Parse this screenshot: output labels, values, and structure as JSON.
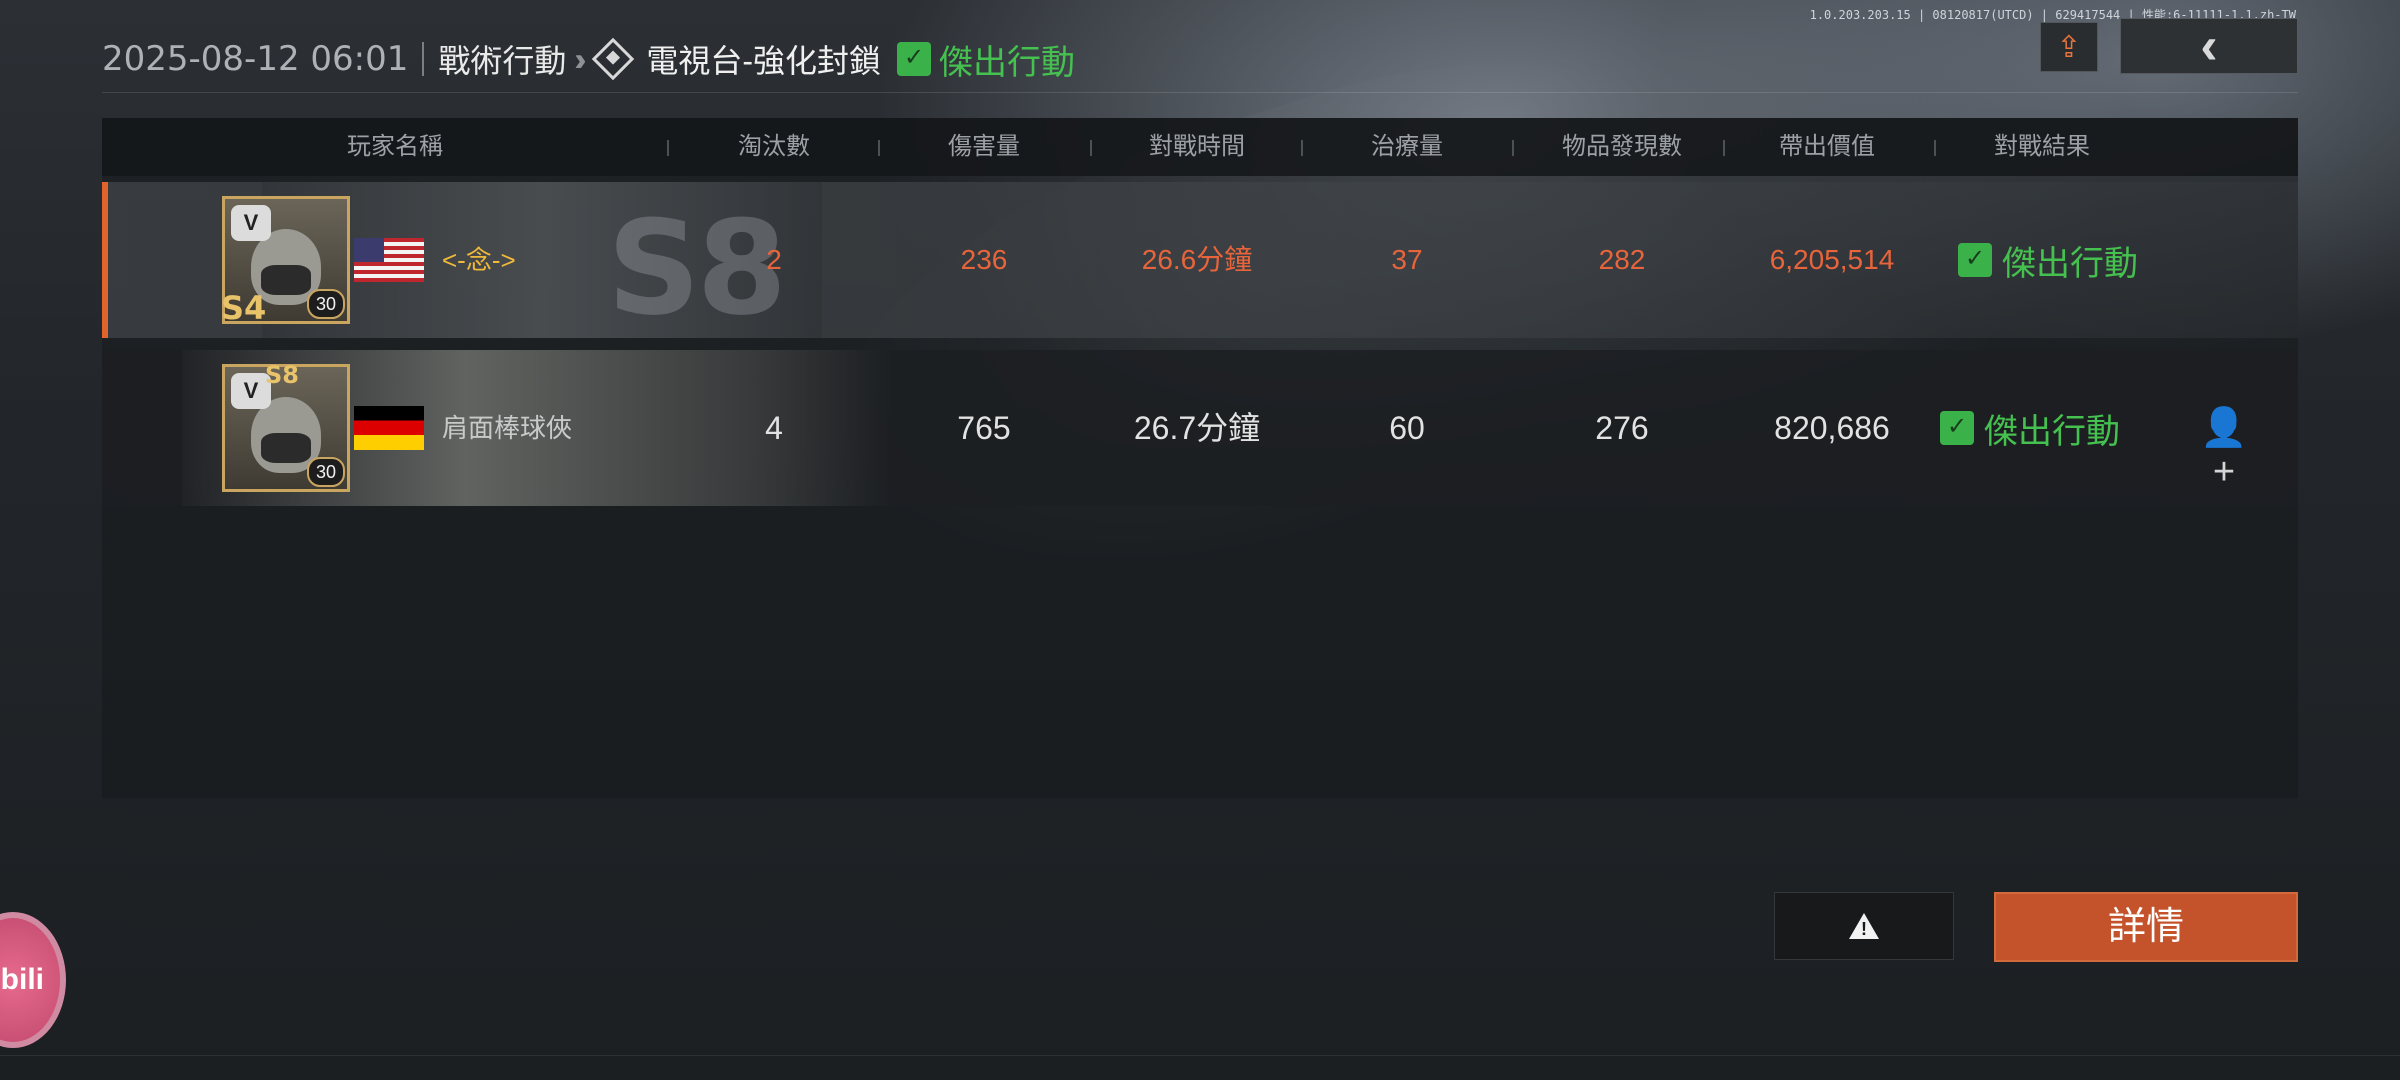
{
  "version_text": "1.0.203.203.15 | 08120817(UTCD) | 629417544 | 性能:6-11111-1.1.zh-TW",
  "header": {
    "datetime": "2025-08-12 06:01",
    "mode": "戰術行動",
    "map": "電視台-強化封鎖",
    "result": "傑出行動",
    "result_icon": "thumbs-up-icon",
    "map_icon": "diamond-map-icon"
  },
  "top_buttons": {
    "share_icon": "share-icon",
    "back_icon": "back-icon"
  },
  "columns": [
    "玩家名稱",
    "淘汰數",
    "傷害量",
    "對戰時間",
    "治療量",
    "物品發現數",
    "帶出價值",
    "對戰結果"
  ],
  "players": [
    {
      "season_badge": "S4",
      "season_watermark": "S8",
      "level": "30",
      "flag": "us",
      "name": "<-念->",
      "name_color": "#f0b93a",
      "kills": "2",
      "damage": "236",
      "time": "26.6分鐘",
      "heal": "37",
      "items": "282",
      "value": "6,205,514",
      "result": "傑出行動",
      "highlight_color": "#e8643a"
    },
    {
      "season_badge": "S8",
      "level": "30",
      "flag": "de",
      "name": "肩面棒球俠",
      "name_color": "#c9c9c9",
      "kills": "4",
      "damage": "765",
      "time": "26.7分鐘",
      "heal": "60",
      "items": "276",
      "value": "820,686",
      "result": "傑出行動"
    }
  ],
  "buttons": {
    "details": "詳情",
    "report_icon": "warning-icon"
  },
  "overlay": {
    "bili_text": "bili"
  },
  "colors": {
    "accent": "#c4532b",
    "success": "#45c14f",
    "gold": "#c9a560"
  }
}
